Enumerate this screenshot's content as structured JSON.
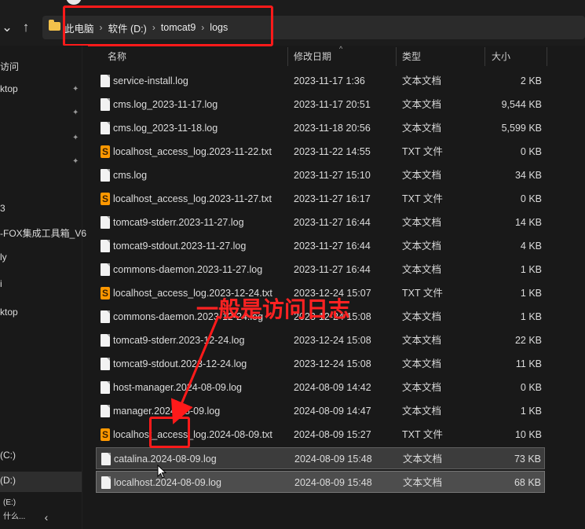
{
  "address_bar": {
    "crumbs": [
      "此电脑",
      "软件 (D:)",
      "tomcat9",
      "logs"
    ],
    "separator": "›"
  },
  "icons": {
    "back": "chevron-left-icon",
    "up": "arrow-up-icon",
    "folder": "folder-icon",
    "log_file": "document-icon",
    "txt_file": "sublime-text-icon",
    "pin": "pin-icon"
  },
  "sidebar": {
    "items": [
      {
        "label": "访问",
        "pinned": false
      },
      {
        "label": "ktop",
        "pinned": true
      },
      {
        "label": "",
        "pinned": true
      },
      {
        "label": "",
        "pinned": true
      },
      {
        "label": "",
        "pinned": true
      },
      {
        "label": "3",
        "pinned": false
      },
      {
        "label": "-FOX集成工具箱_V6",
        "pinned": false
      },
      {
        "label": "ly",
        "pinned": false
      },
      {
        "label": "i",
        "pinned": false
      },
      {
        "label": "ktop",
        "pinned": false
      },
      {
        "label": "(C:)",
        "pinned": false
      },
      {
        "label": "(D:)",
        "pinned": false
      },
      {
        "label": "(E:)",
        "pinned": false
      },
      {
        "label": "什么...",
        "pinned": false
      }
    ]
  },
  "columns": {
    "name": "名称",
    "date": "修改日期",
    "type": "类型",
    "size": "大小"
  },
  "files": [
    {
      "name": "service-install.log",
      "date": "2023-11-17 1:36",
      "type": "文本文档",
      "size": "2 KB",
      "icon": "log"
    },
    {
      "name": "cms.log_2023-11-17.log",
      "date": "2023-11-17 20:51",
      "type": "文本文档",
      "size": "9,544 KB",
      "icon": "log"
    },
    {
      "name": "cms.log_2023-11-18.log",
      "date": "2023-11-18 20:56",
      "type": "文本文档",
      "size": "5,599 KB",
      "icon": "log"
    },
    {
      "name": "localhost_access_log.2023-11-22.txt",
      "date": "2023-11-22 14:55",
      "type": "TXT 文件",
      "size": "0 KB",
      "icon": "txt"
    },
    {
      "name": "cms.log",
      "date": "2023-11-27 15:10",
      "type": "文本文档",
      "size": "34 KB",
      "icon": "log"
    },
    {
      "name": "localhost_access_log.2023-11-27.txt",
      "date": "2023-11-27 16:17",
      "type": "TXT 文件",
      "size": "0 KB",
      "icon": "txt"
    },
    {
      "name": "tomcat9-stderr.2023-11-27.log",
      "date": "2023-11-27 16:44",
      "type": "文本文档",
      "size": "14 KB",
      "icon": "log"
    },
    {
      "name": "tomcat9-stdout.2023-11-27.log",
      "date": "2023-11-27 16:44",
      "type": "文本文档",
      "size": "4 KB",
      "icon": "log"
    },
    {
      "name": "commons-daemon.2023-11-27.log",
      "date": "2023-11-27 16:44",
      "type": "文本文档",
      "size": "1 KB",
      "icon": "log"
    },
    {
      "name": "localhost_access_log.2023-12-24.txt",
      "date": "2023-12-24 15:07",
      "type": "TXT 文件",
      "size": "1 KB",
      "icon": "txt"
    },
    {
      "name": "commons-daemon.2023-12-24.log",
      "date": "2023-12-24 15:08",
      "type": "文本文档",
      "size": "1 KB",
      "icon": "log"
    },
    {
      "name": "tomcat9-stderr.2023-12-24.log",
      "date": "2023-12-24 15:08",
      "type": "文本文档",
      "size": "22 KB",
      "icon": "log"
    },
    {
      "name": "tomcat9-stdout.2023-12-24.log",
      "date": "2023-12-24 15:08",
      "type": "文本文档",
      "size": "11 KB",
      "icon": "log"
    },
    {
      "name": "host-manager.2024-08-09.log",
      "date": "2024-08-09 14:42",
      "type": "文本文档",
      "size": "0 KB",
      "icon": "log"
    },
    {
      "name": "manager.2024-08-09.log",
      "date": "2024-08-09 14:47",
      "type": "文本文档",
      "size": "1 KB",
      "icon": "log"
    },
    {
      "name": "localhost_access_log.2024-08-09.txt",
      "date": "2024-08-09 15:27",
      "type": "TXT 文件",
      "size": "10 KB",
      "icon": "txt"
    },
    {
      "name": "catalina.2024-08-09.log",
      "date": "2024-08-09 15:48",
      "type": "文本文档",
      "size": "73 KB",
      "icon": "log",
      "state": "selected"
    },
    {
      "name": "localhost.2024-08-09.log",
      "date": "2024-08-09 15:48",
      "type": "文本文档",
      "size": "68 KB",
      "icon": "log",
      "state": "selected-hover"
    }
  ],
  "annotation": {
    "text": "一般是访问日志",
    "color": "#ff1a1a"
  }
}
